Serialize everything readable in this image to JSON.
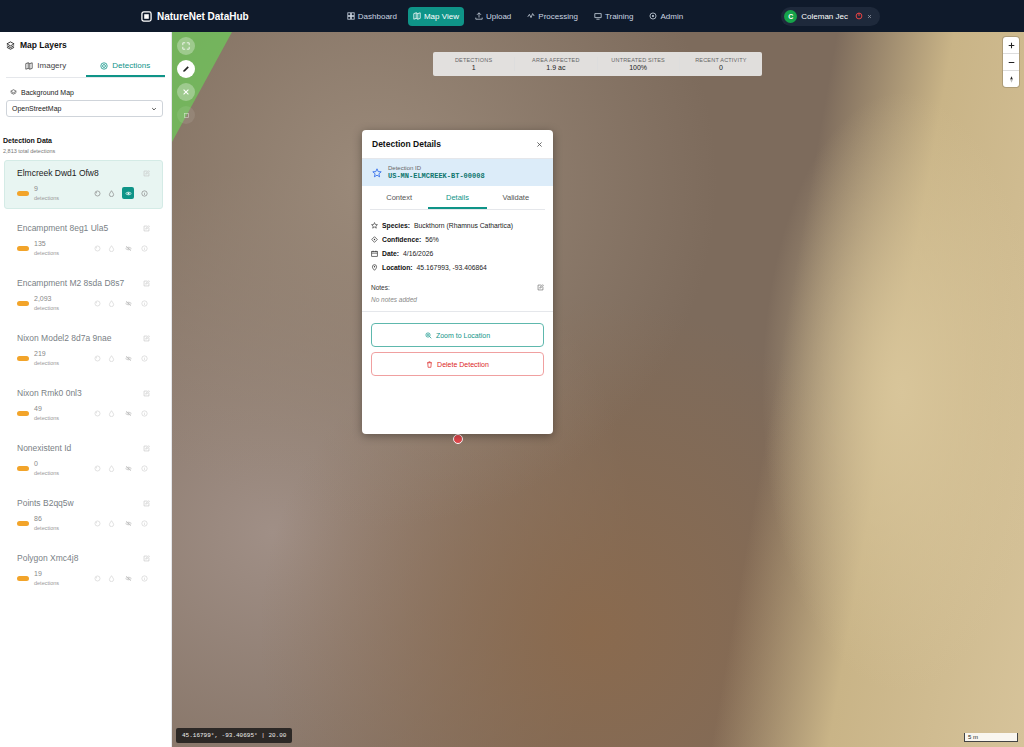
{
  "app": {
    "title": "NatureNet DataHub"
  },
  "nav": [
    {
      "label": "Dashboard",
      "selected": false
    },
    {
      "label": "Map View",
      "selected": true
    },
    {
      "label": "Upload",
      "selected": false
    },
    {
      "label": "Processing",
      "selected": false
    },
    {
      "label": "Training",
      "selected": false
    },
    {
      "label": "Admin",
      "selected": false
    }
  ],
  "user": {
    "initial": "C",
    "name": "Coleman Jec"
  },
  "sidebar": {
    "title": "Map Layers",
    "tabs": [
      {
        "label": "Imagery",
        "selected": false
      },
      {
        "label": "Detections",
        "selected": true
      }
    ],
    "background_label": "Background Map",
    "background_value": "OpenStreetMap",
    "section_title": "Detection Data",
    "total": "2,813 total detections",
    "layers": [
      {
        "name": "Elmcreek Dwd1 Ofw8",
        "count": "9",
        "unit": "detections",
        "selected": true,
        "visible": true
      },
      {
        "name": "Encampment 8eg1 Ula5",
        "count": "135",
        "unit": "detections",
        "selected": false,
        "visible": false
      },
      {
        "name": "Encampment M2 8sda D8s7",
        "count": "2,093",
        "unit": "detections",
        "selected": false,
        "visible": false
      },
      {
        "name": "Nixon Model2 8d7a 9nae",
        "count": "219",
        "unit": "detections",
        "selected": false,
        "visible": false
      },
      {
        "name": "Nixon Rmk0 0nl3",
        "count": "49",
        "unit": "detections",
        "selected": false,
        "visible": false
      },
      {
        "name": "Nonexistent Id",
        "count": "0",
        "unit": "detections",
        "selected": false,
        "visible": false
      },
      {
        "name": "Points B2qq5w",
        "count": "86",
        "unit": "detections",
        "selected": false,
        "visible": false
      },
      {
        "name": "Polygon Xmc4j8",
        "count": "19",
        "unit": "detections",
        "selected": false,
        "visible": false
      }
    ]
  },
  "map": {
    "stats": [
      {
        "label": "DETECTIONS",
        "value": "1"
      },
      {
        "label": "AREA AFFECTED",
        "value": "1.9 ac"
      },
      {
        "label": "UNTREATED SITES",
        "value": "100%"
      },
      {
        "label": "RECENT ACTIVITY",
        "value": "0"
      }
    ],
    "coordinates": "45.16799°, -93.40695° | 20.00",
    "scale": "5 m"
  },
  "popup": {
    "title": "Detection Details",
    "id_label": "Detection ID",
    "id_value": "US-MN-ELMCREEK-BT-00008",
    "tabs": [
      {
        "label": "Context",
        "selected": false
      },
      {
        "label": "Details",
        "selected": true
      },
      {
        "label": "Validate",
        "selected": false
      }
    ],
    "fields": [
      {
        "label": "Species:",
        "value": "Buckthorn (Rhamnus Cathartica)"
      },
      {
        "label": "Confidence:",
        "value": "56%"
      },
      {
        "label": "Date:",
        "value": "4/16/2026"
      },
      {
        "label": "Location:",
        "value": "45.167993, -93.406864"
      }
    ],
    "notes_label": "Notes:",
    "notes_empty": "No notes added",
    "buttons": [
      {
        "label": "Zoom to Location",
        "kind": "primary"
      },
      {
        "label": "Delete Detection",
        "kind": "danger"
      }
    ]
  }
}
